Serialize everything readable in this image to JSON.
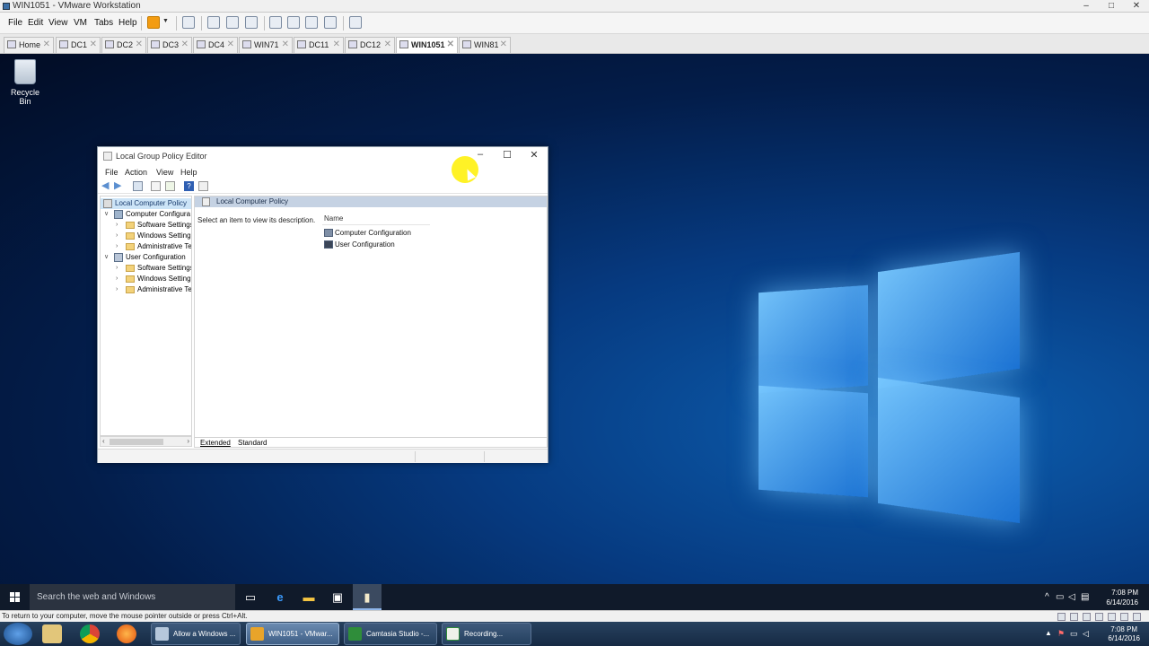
{
  "vmware": {
    "title": "WIN1051 - VMware Workstation",
    "menu": [
      "File",
      "Edit",
      "View",
      "VM",
      "Tabs",
      "Help"
    ],
    "controls": {
      "minimize": "–",
      "maximize": "□",
      "close": "✕"
    },
    "tabs": [
      {
        "label": "Home",
        "active": false
      },
      {
        "label": "DC1",
        "active": false
      },
      {
        "label": "DC2",
        "active": false
      },
      {
        "label": "DC3",
        "active": false
      },
      {
        "label": "DC4",
        "active": false
      },
      {
        "label": "WIN71",
        "active": false
      },
      {
        "label": "DC11",
        "active": false
      },
      {
        "label": "DC12",
        "active": false
      },
      {
        "label": "WIN1051",
        "active": true
      },
      {
        "label": "WIN81",
        "active": false
      }
    ],
    "tab_close_glyph": "✕",
    "status_text": "To return to your computer, move the mouse pointer outside or press Ctrl+Alt."
  },
  "desktop": {
    "recycle_bin_label": "Recycle Bin"
  },
  "gpedit": {
    "title": "Local Group Policy Editor",
    "controls": {
      "minimize": "–",
      "maximize": "☐",
      "close": "✕"
    },
    "menu": [
      "File",
      "Action",
      "View",
      "Help"
    ],
    "tree": {
      "root": "Local Computer Policy",
      "items": [
        {
          "label": "Computer Configura",
          "level": 1,
          "expanded": true,
          "icon": "computer-icon"
        },
        {
          "label": "Software Settings",
          "level": 2,
          "expanded": false,
          "icon": "folder-icon"
        },
        {
          "label": "Windows Setting",
          "level": 2,
          "expanded": false,
          "icon": "folder-icon"
        },
        {
          "label": "Administrative Te",
          "level": 2,
          "expanded": false,
          "icon": "folder-icon"
        },
        {
          "label": "User Configuration",
          "level": 1,
          "expanded": true,
          "icon": "user-icon"
        },
        {
          "label": "Software Settings",
          "level": 2,
          "expanded": false,
          "icon": "folder-icon"
        },
        {
          "label": "Windows Setting",
          "level": 2,
          "expanded": false,
          "icon": "folder-icon"
        },
        {
          "label": "Administrative Te",
          "level": 2,
          "expanded": false,
          "icon": "folder-icon"
        }
      ]
    },
    "right_pane": {
      "header": "Local Computer Policy",
      "description": "Select an item to view its description.",
      "column_name": "Name",
      "items": [
        "Computer Configuration",
        "User Configuration"
      ]
    },
    "view_tabs": [
      "Extended",
      "Standard"
    ]
  },
  "guest_taskbar": {
    "search_placeholder": "Search the web and Windows",
    "time": "7:08 PM",
    "date": "6/14/2016"
  },
  "host_taskbar": {
    "buttons": [
      {
        "label": "Allow a Windows ...",
        "active": false
      },
      {
        "label": "WIN1051 - VMwar...",
        "active": true
      },
      {
        "label": "Camtasia Studio -...",
        "active": false
      },
      {
        "label": "Recording...",
        "active": false
      }
    ],
    "time": "7:08 PM",
    "date": "6/14/2016"
  }
}
